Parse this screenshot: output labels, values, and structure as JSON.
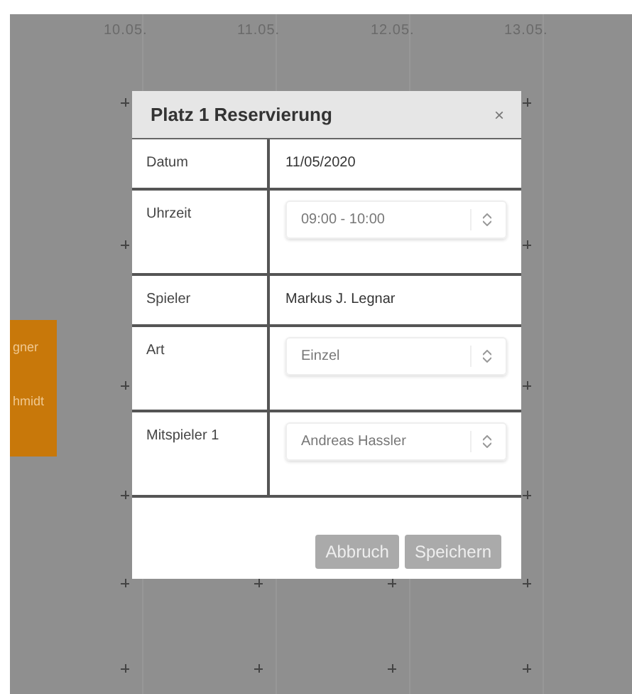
{
  "calendar": {
    "days": [
      "10.05.",
      "11.05.",
      "12.05.",
      "13.05."
    ],
    "event": {
      "lines": [
        "gner",
        "hmidt"
      ],
      "color": "#c8780a"
    }
  },
  "dialog": {
    "title": "Platz 1 Reservierung",
    "close": "×",
    "fields": [
      {
        "label": "Datum",
        "kind": "text",
        "value": "11/05/2020"
      },
      {
        "label": "Uhrzeit",
        "kind": "select",
        "value": "09:00 - 10:00"
      },
      {
        "label": "Spieler",
        "kind": "text",
        "value": "Markus J. Legnar"
      },
      {
        "label": "Art",
        "kind": "select",
        "value": "Einzel"
      },
      {
        "label": "Mitspieler 1",
        "kind": "select",
        "value": "Andreas Hassler"
      }
    ],
    "buttons": [
      "Abbruch",
      "Speichern"
    ]
  }
}
